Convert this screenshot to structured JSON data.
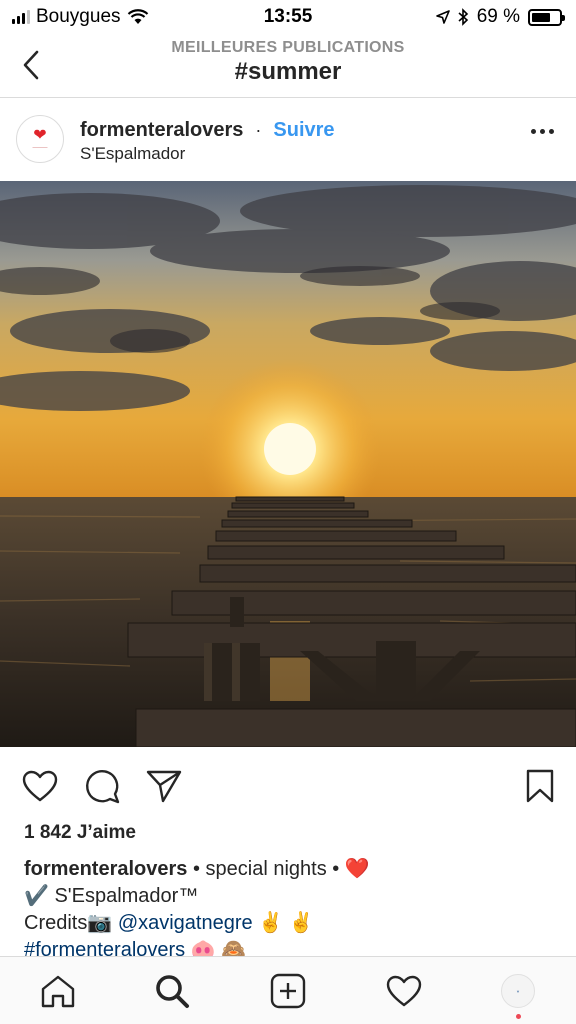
{
  "status_bar": {
    "carrier": "Bouygues",
    "time": "13:55",
    "battery_percent": "69 %",
    "battery_level": 0.69
  },
  "header": {
    "subtitle": "MEILLEURES PUBLICATIONS",
    "title": "#summer"
  },
  "post": {
    "username": "formenteralovers",
    "separator": "·",
    "follow_label": "Suivre",
    "location": "S'Espalmador",
    "likes": "1 842 J’aime",
    "caption": {
      "username": "formenteralovers",
      "line1_text": " • special nights • ",
      "line1_emoji": "❤️",
      "line2": "✔️ S'Espalmador™",
      "line3_prefix": "Credits📷 ",
      "line3_mention": "@xavigatnegre",
      "line3_suffix": " ✌️ ✌️",
      "line4_hashtag": "#formenteralovers",
      "line4_suffix": " 🐽 🙈"
    }
  },
  "icons": {
    "back": "chevron-left-icon",
    "more": "more-horizontal-icon",
    "like": "heart-outline-icon",
    "comment": "comment-bubble-icon",
    "share": "paper-plane-icon",
    "save": "bookmark-icon",
    "home": "home-icon",
    "search": "search-icon",
    "add": "plus-square-icon",
    "activity": "heart-outline-icon",
    "profile": "profile-avatar-icon"
  },
  "colors": {
    "link": "#3897f0",
    "text": "#262626",
    "muted": "#8e8e8e",
    "heart": "#e0242b",
    "notification": "#ed4956"
  }
}
